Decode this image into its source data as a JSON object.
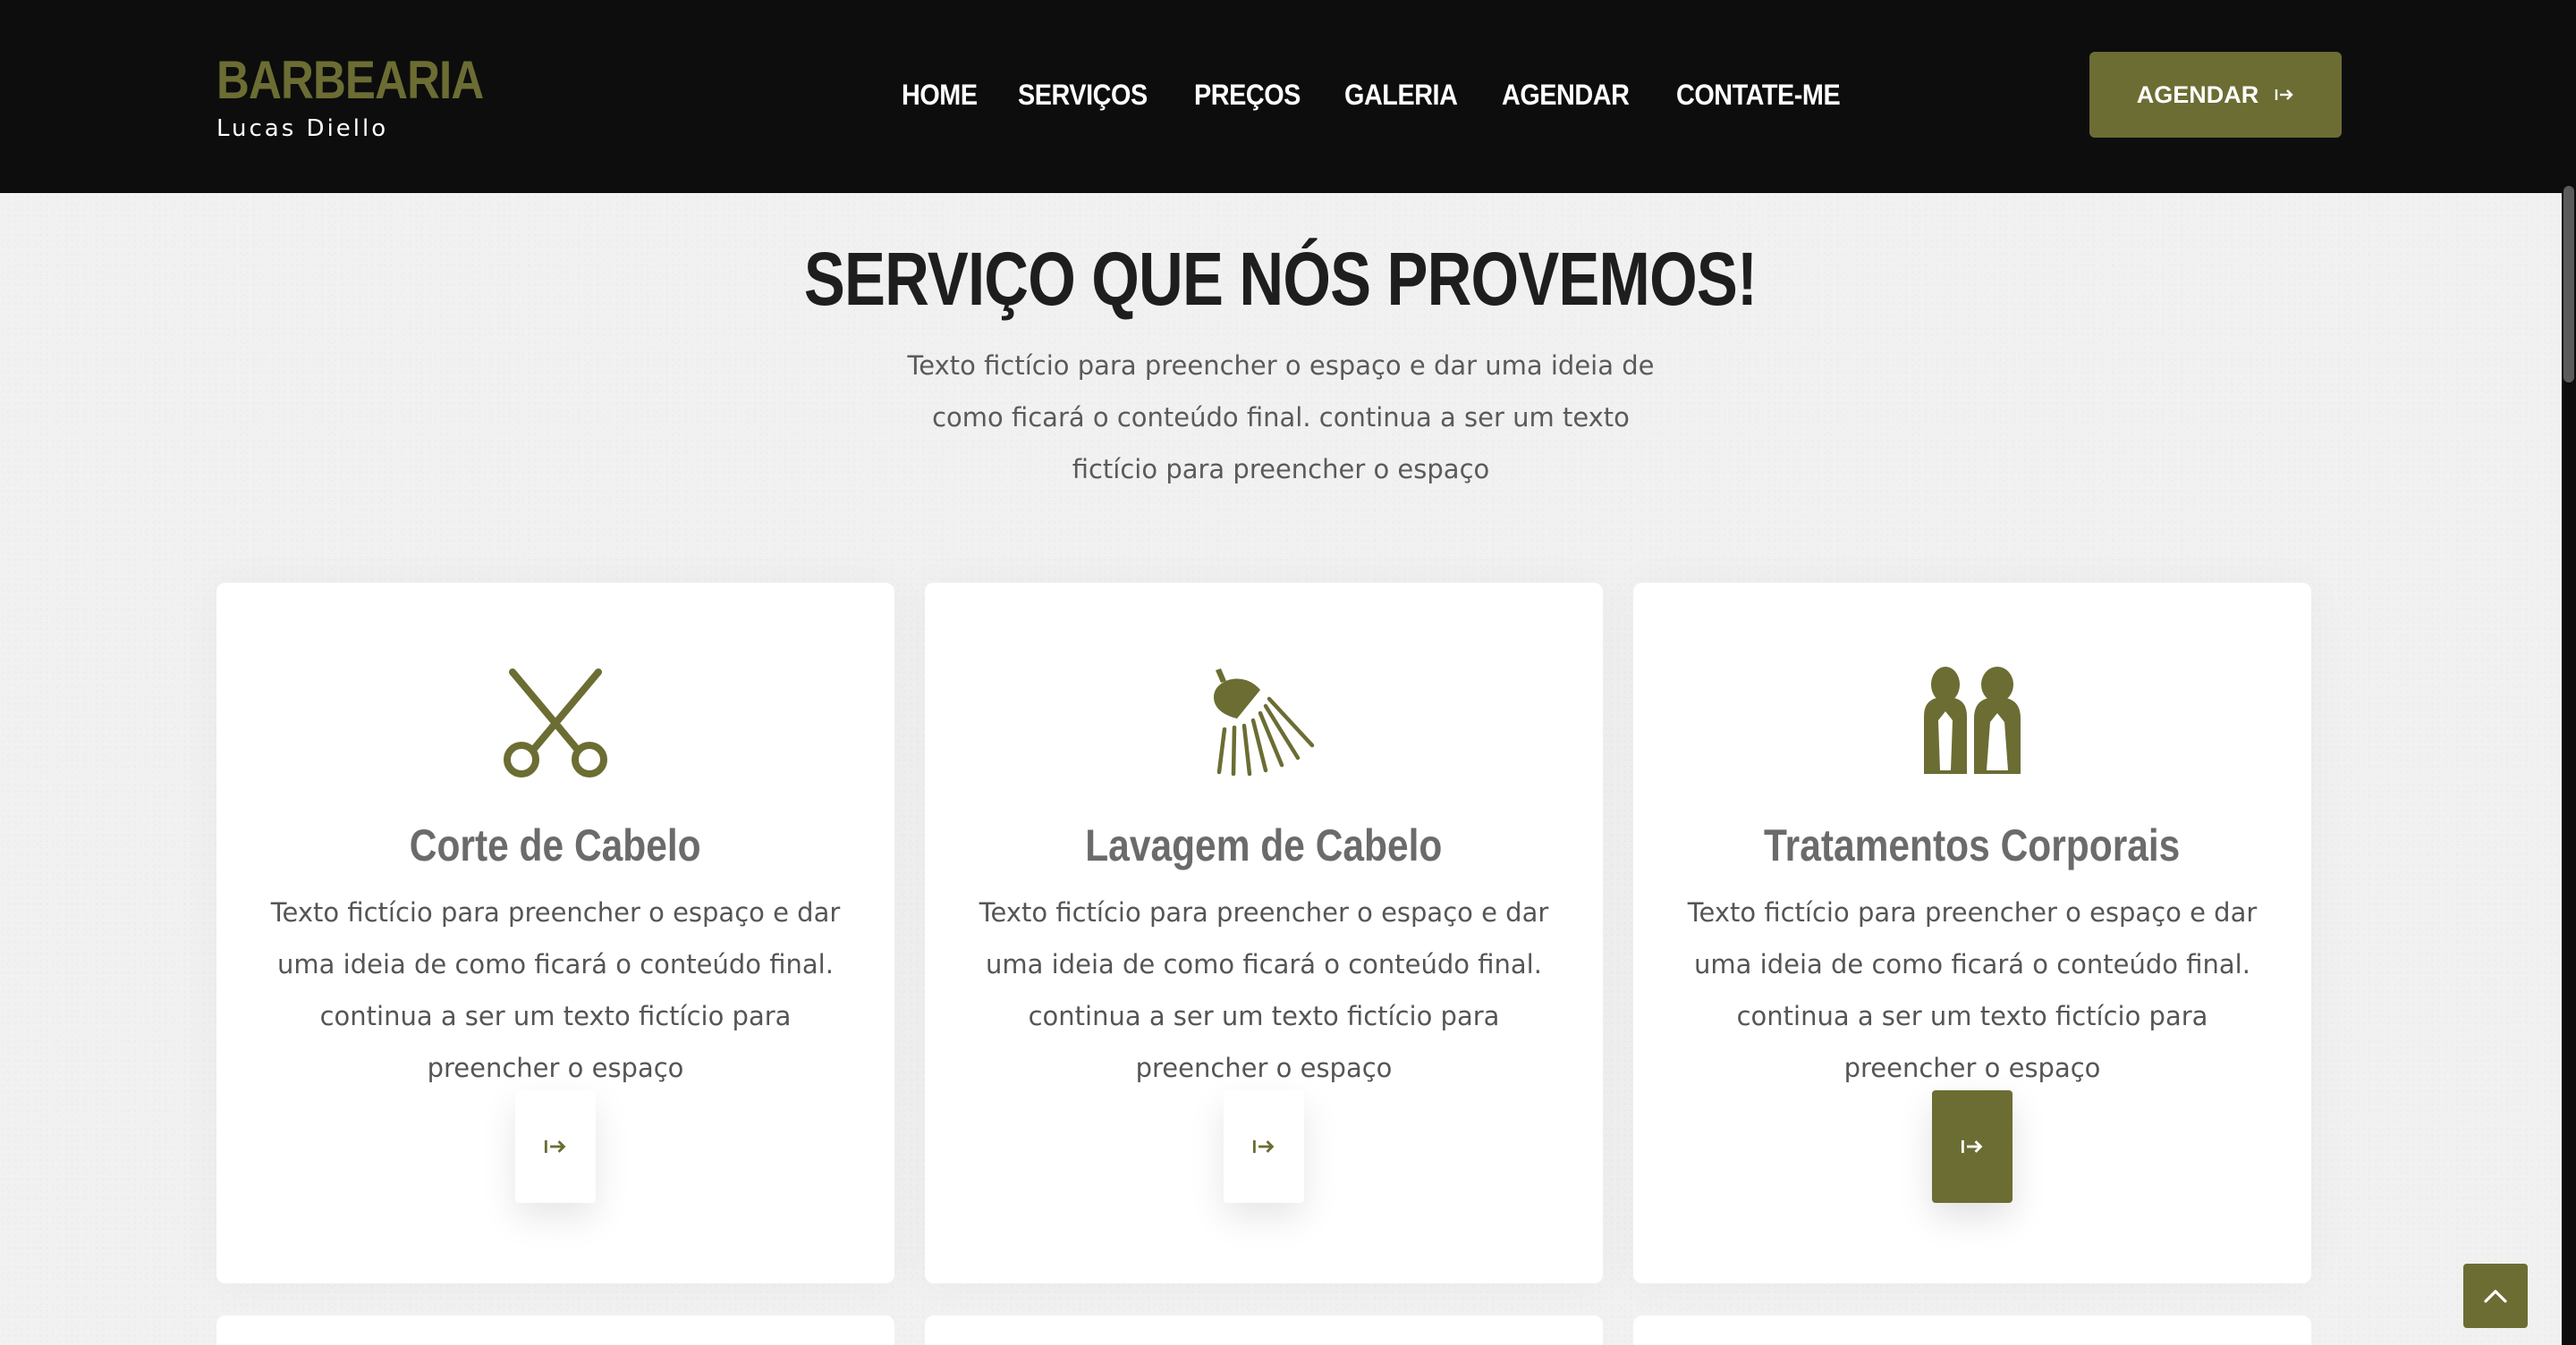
{
  "brand": {
    "title": "BARBEARIA",
    "subtitle": "Lucas Diello"
  },
  "nav": {
    "items": [
      "HOME",
      "SERVIÇOS",
      "PREÇOS",
      "GALERIA",
      "AGENDAR",
      "CONTATE-ME"
    ],
    "cta_label": "AGENDAR"
  },
  "section": {
    "title": "SERVIÇO QUE NÓS PROVEMOS!",
    "description": "Texto fictício para preencher o espaço e dar uma ideia de como ficará o conteúdo final. continua a ser um texto fictício para preencher o espaço"
  },
  "services": [
    {
      "title": "Corte de Cabelo",
      "icon": "scissors-icon",
      "text": "Texto fictício para preencher o espaço e dar uma ideia de como ficará o conteúdo final. continua a ser um texto fictício para preencher o espaço"
    },
    {
      "title": "Lavagem de Cabelo",
      "icon": "shower-icon",
      "text": "Texto fictício para preencher o espaço e dar uma ideia de como ficará o conteúdo final. continua a ser um texto fictício para preencher o espaço"
    },
    {
      "title": "Tratamentos Corporais",
      "icon": "body-treatment-icon",
      "text": "Texto fictício para preencher o espaço e dar uma ideia de como ficará o conteúdo final. continua a ser um texto fictício para preencher o espaço"
    }
  ],
  "colors": {
    "accent": "#6b6d33",
    "header_bg": "#0d0d0d",
    "page_bg": "#f1f1f1",
    "card_bg": "#ffffff"
  },
  "icons": {
    "arrow": "arrow-right-to-bar-icon",
    "scroll_top": "chevron-up-icon"
  }
}
